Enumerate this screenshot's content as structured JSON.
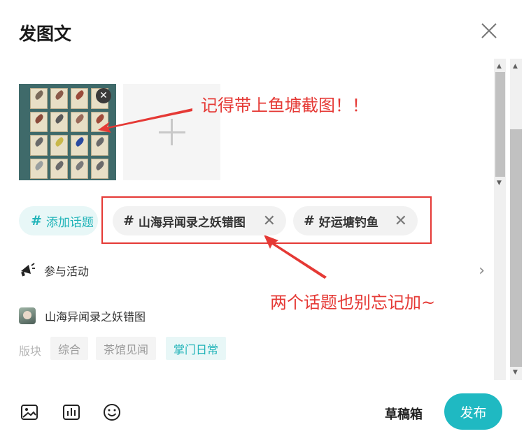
{
  "dialog": {
    "title": "发图文"
  },
  "annotations": {
    "screenshot_note": "记得带上鱼塘截图！！",
    "topics_note": "两个话题也别忘记加~"
  },
  "topics": {
    "add_label": "添加话题",
    "hash": "#",
    "chips": [
      {
        "label": "山海异闻录之妖错图"
      },
      {
        "label": "好运塘钓鱼"
      }
    ]
  },
  "activity": {
    "label": "参与活动"
  },
  "game": {
    "name": "山海异闻录之妖错图"
  },
  "board": {
    "label": "版块",
    "tags": [
      {
        "label": "综合",
        "selected": false
      },
      {
        "label": "茶馆见闻",
        "selected": false
      },
      {
        "label": "掌门日常",
        "selected": true
      }
    ]
  },
  "footer": {
    "drafts_label": "草稿箱",
    "publish_label": "发布"
  },
  "icons": {
    "close": "close-icon",
    "remove_image": "close-icon",
    "add_image": "plus-icon",
    "activity": "megaphone-icon",
    "chevron": "chevron-right-icon",
    "toolbar": [
      "image-icon",
      "poll-icon",
      "emoji-icon"
    ]
  },
  "colors": {
    "accent": "#1fb9c2",
    "annotation": "#e53935",
    "accent_bg": "#e8f7f7"
  }
}
